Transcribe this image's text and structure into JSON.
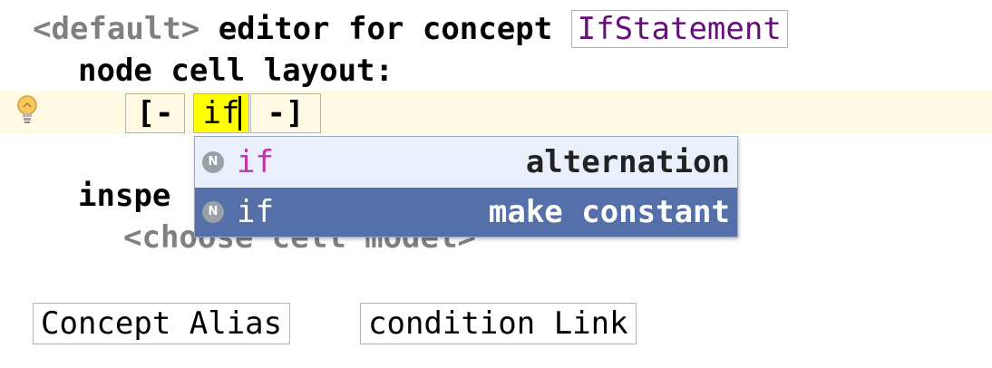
{
  "editor": {
    "header_prefix": "<default>",
    "header_text": " editor for concept ",
    "concept_name": "IfStatement",
    "node_cell_layout": "node cell layout:",
    "collection_open": "[-",
    "keyword_cell": "if",
    "collection_close": "-]",
    "inspected_label": "inspe",
    "choose_cell_model": "<choose cell model>",
    "concept_alias": "Concept Alias",
    "condition_link": "condition Link"
  },
  "completion": {
    "items": [
      {
        "badge": "N",
        "match": "if",
        "description": "alternation",
        "selected": false
      },
      {
        "badge": "N",
        "match": "if",
        "description": "make constant",
        "selected": true
      }
    ]
  },
  "icons": {
    "intention": "lightbulb-icon",
    "node": "node-icon"
  },
  "colors": {
    "keyword_highlight": "#ffff00",
    "current_line": "#fdf9e3",
    "selection": "#5570a9",
    "concept_name": "#660e7a",
    "match_text": "#c032a8"
  }
}
